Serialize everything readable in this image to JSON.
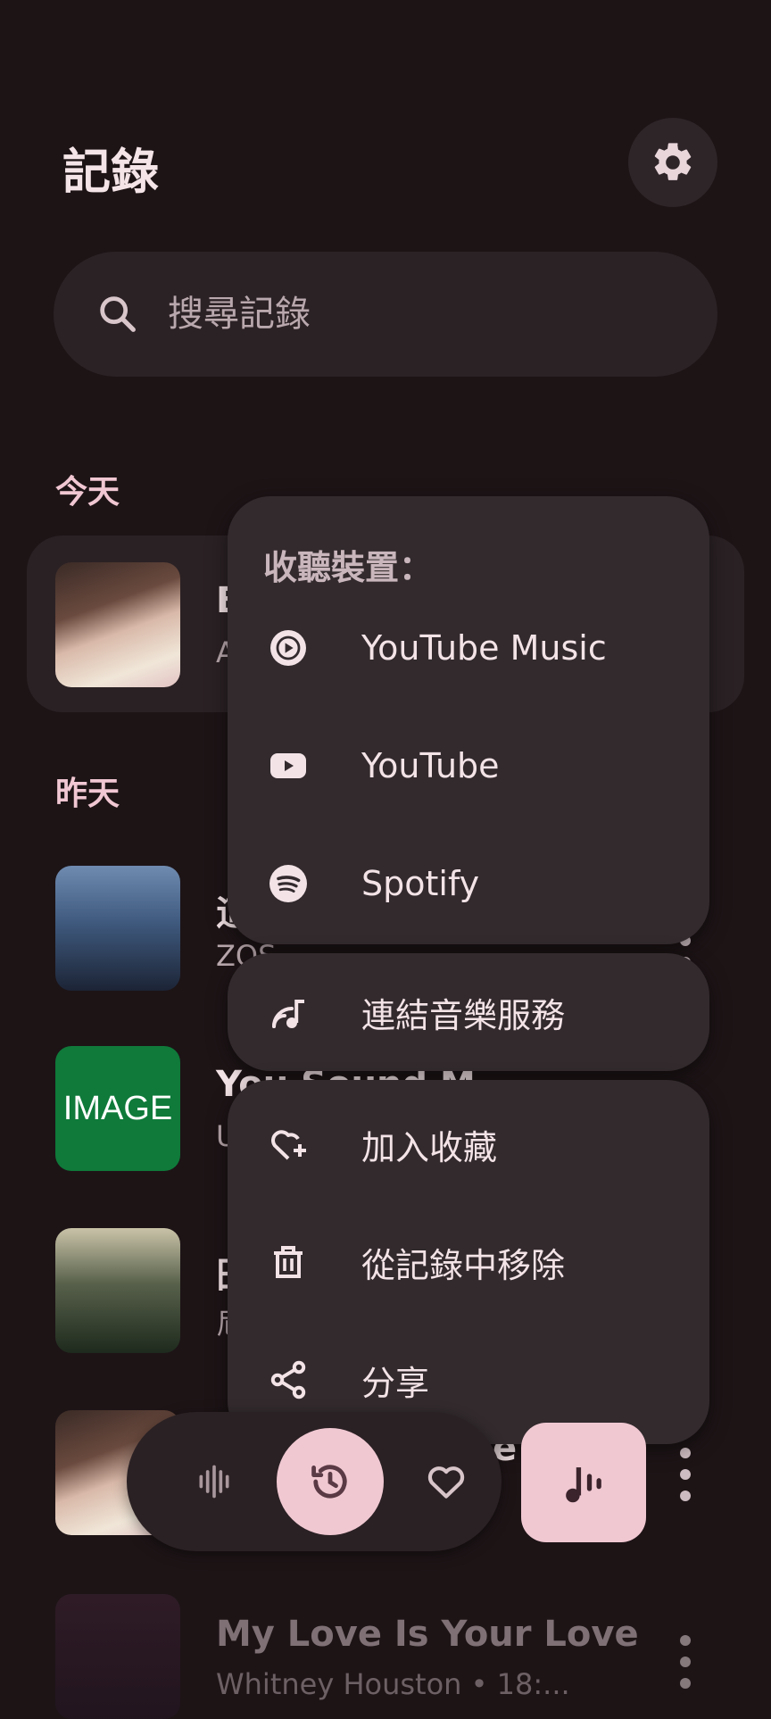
{
  "header": {
    "title": "記錄",
    "settings_icon": "gear-icon"
  },
  "search": {
    "placeholder": "搜尋記錄"
  },
  "sections": {
    "today": "今天",
    "yesterday": "昨天"
  },
  "rows": [
    {
      "title_visible": "B",
      "sub_visible": "A"
    },
    {
      "title_visible": "這",
      "sub_visible": "ZOS",
      "thumb_text": ""
    },
    {
      "title_visible": "You Sound M",
      "sub_visible": "U",
      "thumb_text": "IMAGE"
    },
    {
      "title_visible": "田",
      "sub_visible": "尼"
    },
    {
      "title_visible": "e",
      "sub_visible": ""
    },
    {
      "title": "My Love Is Your Love",
      "subtitle": "Whitney Houston • 18:..."
    }
  ],
  "menu": {
    "header": "收聽裝置：",
    "listen_items": [
      {
        "label": "YouTube Music",
        "icon": "youtube-music-icon"
      },
      {
        "label": "YouTube",
        "icon": "youtube-icon"
      },
      {
        "label": "Spotify",
        "icon": "spotify-icon"
      }
    ],
    "connect": {
      "label": "連結音樂服務",
      "icon": "connect-music-icon"
    },
    "actions": [
      {
        "label": "加入收藏",
        "icon": "heart-add-icon"
      },
      {
        "label": "從記錄中移除",
        "icon": "trash-icon"
      },
      {
        "label": "分享",
        "icon": "share-icon"
      }
    ]
  },
  "nav": {
    "items": [
      {
        "icon": "waveform-icon"
      },
      {
        "icon": "history-icon",
        "active": true
      },
      {
        "icon": "heart-icon"
      }
    ],
    "fab_icon": "music-recognize-icon"
  },
  "colors": {
    "background": "#1d1416",
    "accent": "#f0c8d2",
    "surface": "#322a2d"
  }
}
